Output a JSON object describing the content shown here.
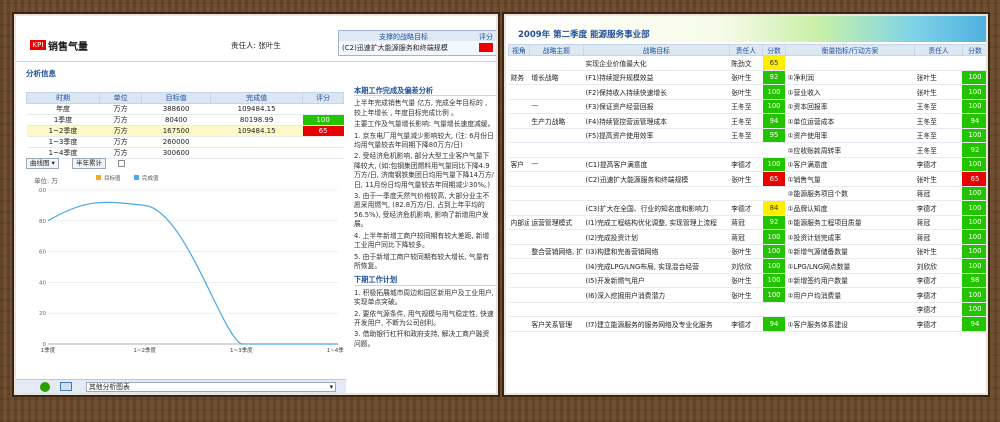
{
  "left": {
    "logo": "KPI",
    "title": "销售气量",
    "owner": "责任人: 张叶生",
    "target_box": {
      "header": "支撑的战略目标",
      "score_header": "评分",
      "row": "(C2)迅速扩大能源服务和终端规模"
    },
    "analysis_section": "分析信息",
    "table": {
      "headers": [
        "时期",
        "单位",
        "目标值",
        "完成值",
        "评分"
      ],
      "rows": [
        {
          "period": "年度",
          "unit": "万方",
          "target": "388600",
          "actual": "109484.15",
          "score": ""
        },
        {
          "period": "1季度",
          "unit": "万方",
          "target": "80400",
          "actual": "80198.99",
          "score": "100"
        },
        {
          "period": "1~2季度",
          "unit": "万方",
          "target": "167500",
          "actual": "109484.15",
          "score": "65"
        },
        {
          "period": "1~3季度",
          "unit": "万方",
          "target": "260000",
          "actual": "",
          "score": ""
        },
        {
          "period": "1~4季度",
          "unit": "万方",
          "target": "300600",
          "actual": "",
          "score": ""
        }
      ]
    },
    "toolbar": {
      "btn1": "曲线图",
      "btn2": "半年累计",
      "unit_label": "单位: 万",
      "legend1": "目标值",
      "legend2": "完成值"
    },
    "chart_data": {
      "type": "line",
      "x": [
        "1季度",
        "1~2季度",
        "1~3季度",
        "1~4季度"
      ],
      "series": [
        {
          "name": "完成值",
          "values": [
            80,
            90,
            0,
            0
          ]
        }
      ],
      "y_ticks": [
        "0",
        "20",
        "40",
        "60",
        "80",
        "100"
      ],
      "ylim": [
        0,
        100
      ],
      "grid": true,
      "legend": "top-left"
    },
    "footer": {
      "label": "其他分析图表"
    },
    "analysis": {
      "title1": "本期工作完成及偏差分析",
      "para1": "上半年完成销售气量 亿方, 完成全年目标的 , 较上年增长 , 年度目标完成比例 。",
      "para2": "主要工作及气量增长影响: 气量增长速度减缓。",
      "items": [
        "1. 京东电厂用气量减少影响较大, (注: 6月份日均用气量较去年同期下降80万方/日)",
        "2. 受经济危机影响, 部分大型工业客户气量下降较大, (如:包钢集团燃料用气量同比下降4.9万方/日, 济南钢铁集团日均用气量下降14万方/日, 11月份日均用气量较去年同期减少30%。)",
        "3. 由于一季度天然气价格较高, 大部分业主不愿采用燃气, (82.8万方/日, 占到上年平均的56.5%), 受经济危机影响, 影响了新增用户发展。",
        "4. 上半年新增工商户较同期有较大差距, 新增工业用户同比下降较多。",
        "5. 由于新增工商户较同期有较大增长, 气量有所恢复。"
      ],
      "title2": "下期工作计划",
      "plan": [
        "1. 积极拓展城市周边和园区新用户及工业用户, 实现单点突破。",
        "2. 要依气源条件, 用气规模与用气稳定性, 快速开发用户, 不断为公司创利。",
        "3. 借助银行杠杆和政府支持, 解决工商户融资问题。"
      ]
    }
  },
  "right": {
    "title": "2009年 第二季度 能源服务事业部",
    "headers": [
      "视角",
      "战略主题",
      "战略目标",
      "责任人",
      "分数",
      "衡量指标/行动方案",
      "责任人",
      "分数"
    ],
    "rows": [
      {
        "view": "",
        "theme": "",
        "goal": "实现企业价值最大化",
        "owner": "陈劲文",
        "score": "65",
        "score_color": "yellow",
        "kpi": "",
        "kpi_owner": "",
        "kpi_score": "",
        "kpi_color": ""
      },
      {
        "view": "财务",
        "theme": "增长战略",
        "goal": "(F1)持续提升规模效益",
        "owner": "张叶生",
        "score": "92",
        "score_color": "green",
        "kpi": "①净利润",
        "kpi_owner": "张叶生",
        "kpi_score": "100",
        "kpi_color": "green"
      },
      {
        "view": "",
        "theme": "",
        "goal": "(F2)保持收入持续快速增长",
        "owner": "张叶生",
        "score": "100",
        "score_color": "green",
        "kpi": "①营业收入",
        "kpi_owner": "张叶生",
        "kpi_score": "100",
        "kpi_color": "green"
      },
      {
        "view": "",
        "theme": "—",
        "goal": "(F3)保证资产经营回报",
        "owner": "王冬至",
        "score": "100",
        "score_color": "green",
        "kpi": "①资本回报率",
        "kpi_owner": "王冬至",
        "kpi_score": "100",
        "kpi_color": "green"
      },
      {
        "view": "",
        "theme": "生产力战略",
        "goal": "(F4)持续管控营运管理成本",
        "owner": "王冬至",
        "score": "94",
        "score_color": "green",
        "kpi": "①单位运营成本",
        "kpi_owner": "王冬至",
        "kpi_score": "94",
        "kpi_color": "green"
      },
      {
        "view": "",
        "theme": "",
        "goal": "(F5)提高资产使用效率",
        "owner": "王冬至",
        "score": "95",
        "score_color": "green",
        "kpi": "①资产使用率",
        "kpi_owner": "王冬至",
        "kpi_score": "100",
        "kpi_color": "green"
      },
      {
        "view": "",
        "theme": "",
        "goal": "",
        "owner": "",
        "score": "",
        "score_color": "",
        "kpi": "②应收账款周转率",
        "kpi_owner": "王冬至",
        "kpi_score": "92",
        "kpi_color": "green"
      },
      {
        "view": "客户",
        "theme": "—",
        "goal": "(C1)提高客户满意度",
        "owner": "李德才",
        "score": "100",
        "score_color": "green",
        "kpi": "①客户满意度",
        "kpi_owner": "李德才",
        "kpi_score": "100",
        "kpi_color": "green"
      },
      {
        "view": "",
        "theme": "",
        "goal": "(C2)迅速扩大能源服务和终端规模",
        "owner": "张叶生",
        "score": "65",
        "score_color": "red",
        "kpi": "①销售气量",
        "kpi_owner": "张叶生",
        "kpi_score": "65",
        "kpi_color": "red"
      },
      {
        "view": "",
        "theme": "",
        "goal": "",
        "owner": "",
        "score": "",
        "score_color": "",
        "kpi": "②能源服务项目个数",
        "kpi_owner": "蒋冠",
        "kpi_score": "100",
        "kpi_color": "green"
      },
      {
        "view": "",
        "theme": "",
        "goal": "(C3)扩大在全国、行业的知名度和影响力",
        "owner": "李德才",
        "score": "84",
        "score_color": "yellow",
        "kpi": "①品牌认知度",
        "kpi_owner": "李德才",
        "kpi_score": "100",
        "kpi_color": "green"
      },
      {
        "view": "内部运营",
        "theme": "运营管理模式",
        "goal": "(I1)完成工程结构优化调整, 实现管理上流程",
        "owner": "蒋冠",
        "score": "92",
        "score_color": "green",
        "kpi": "①能源服务工程项目质量",
        "kpi_owner": "蒋冠",
        "kpi_score": "100",
        "kpi_color": "green"
      },
      {
        "view": "",
        "theme": "",
        "goal": "(I2)完成投资计划",
        "owner": "蒋冠",
        "score": "100",
        "score_color": "green",
        "kpi": "①投资计划完成率",
        "kpi_owner": "蒋冠",
        "kpi_score": "100",
        "kpi_color": "green"
      },
      {
        "view": "",
        "theme": "整合营销网络, 扩大市场规模",
        "goal": "(I3)构建和完善营销网络",
        "owner": "张叶生",
        "score": "100",
        "score_color": "green",
        "kpi": "①新增气源储备数量",
        "kpi_owner": "张叶生",
        "kpi_score": "100",
        "kpi_color": "green"
      },
      {
        "view": "",
        "theme": "",
        "goal": "(I4)完成LPG/LNG布局, 实现混合经营",
        "owner": "刘欣欣",
        "score": "100",
        "score_color": "green",
        "kpi": "①LPG/LNG网点数量",
        "kpi_owner": "刘欣欣",
        "kpi_score": "100",
        "kpi_color": "green"
      },
      {
        "view": "",
        "theme": "",
        "goal": "(I5)开发新燃气用户",
        "owner": "张叶生",
        "score": "100",
        "score_color": "green",
        "kpi": "①新增签约用户数量",
        "kpi_owner": "李德才",
        "kpi_score": "98",
        "kpi_color": "green"
      },
      {
        "view": "",
        "theme": "",
        "goal": "(I6)深入挖掘用户消费潜力",
        "owner": "张叶生",
        "score": "100",
        "score_color": "green",
        "kpi": "①用户户均消费量",
        "kpi_owner": "李德才",
        "kpi_score": "100",
        "kpi_color": "green"
      },
      {
        "view": "",
        "theme": "",
        "goal": "",
        "owner": "",
        "score": "",
        "score_color": "",
        "kpi": "",
        "kpi_owner": "李德才",
        "kpi_score": "100",
        "kpi_color": "green"
      },
      {
        "view": "",
        "theme": "客户关系管理",
        "goal": "(I7)建立能源服务的服务网络及专业化服务",
        "owner": "李德才",
        "score": "94",
        "score_color": "green",
        "kpi": "①客户服务体系建设",
        "kpi_owner": "李德才",
        "kpi_score": "94",
        "kpi_color": "green"
      }
    ]
  }
}
